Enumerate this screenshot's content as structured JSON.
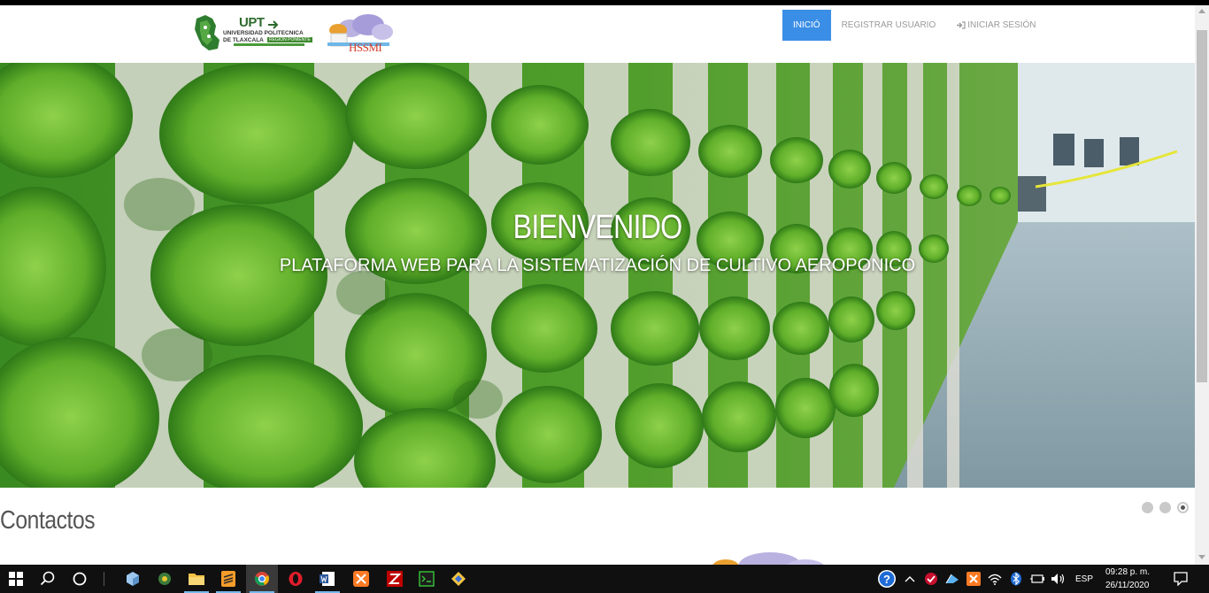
{
  "logos": {
    "upt_word": "UPT",
    "upt_line1": "UNIVERSIDAD POLITECNICA",
    "upt_line2": "DE TLAXCALA",
    "upt_tag": "REGION PONIENTE",
    "hssmi_word": "HSSMI"
  },
  "nav": {
    "items": [
      {
        "label": "INICIÓ"
      },
      {
        "label": "REGISTRAR USUARIO"
      },
      {
        "label": "INICIAR SESIÓN"
      }
    ]
  },
  "hero": {
    "title": "BIENVENIDO",
    "subtitle": "PLATAFORMA WEB PARA LA SISTEMATIZACIÓN DE CULTIVO AEROPONICO"
  },
  "carousel": {
    "slide_count": 3,
    "active_slide": 3
  },
  "section": {
    "contacts_title": "Contactos"
  },
  "taskbar": {
    "language": "ESP",
    "time": "09:28 p. m.",
    "date": "26/11/2020",
    "colors": {
      "background": "#101010",
      "accent": "#76b9ed"
    }
  },
  "colors": {
    "nav_active": "#3b8ee6",
    "nav_text": "#9a9a9a"
  }
}
